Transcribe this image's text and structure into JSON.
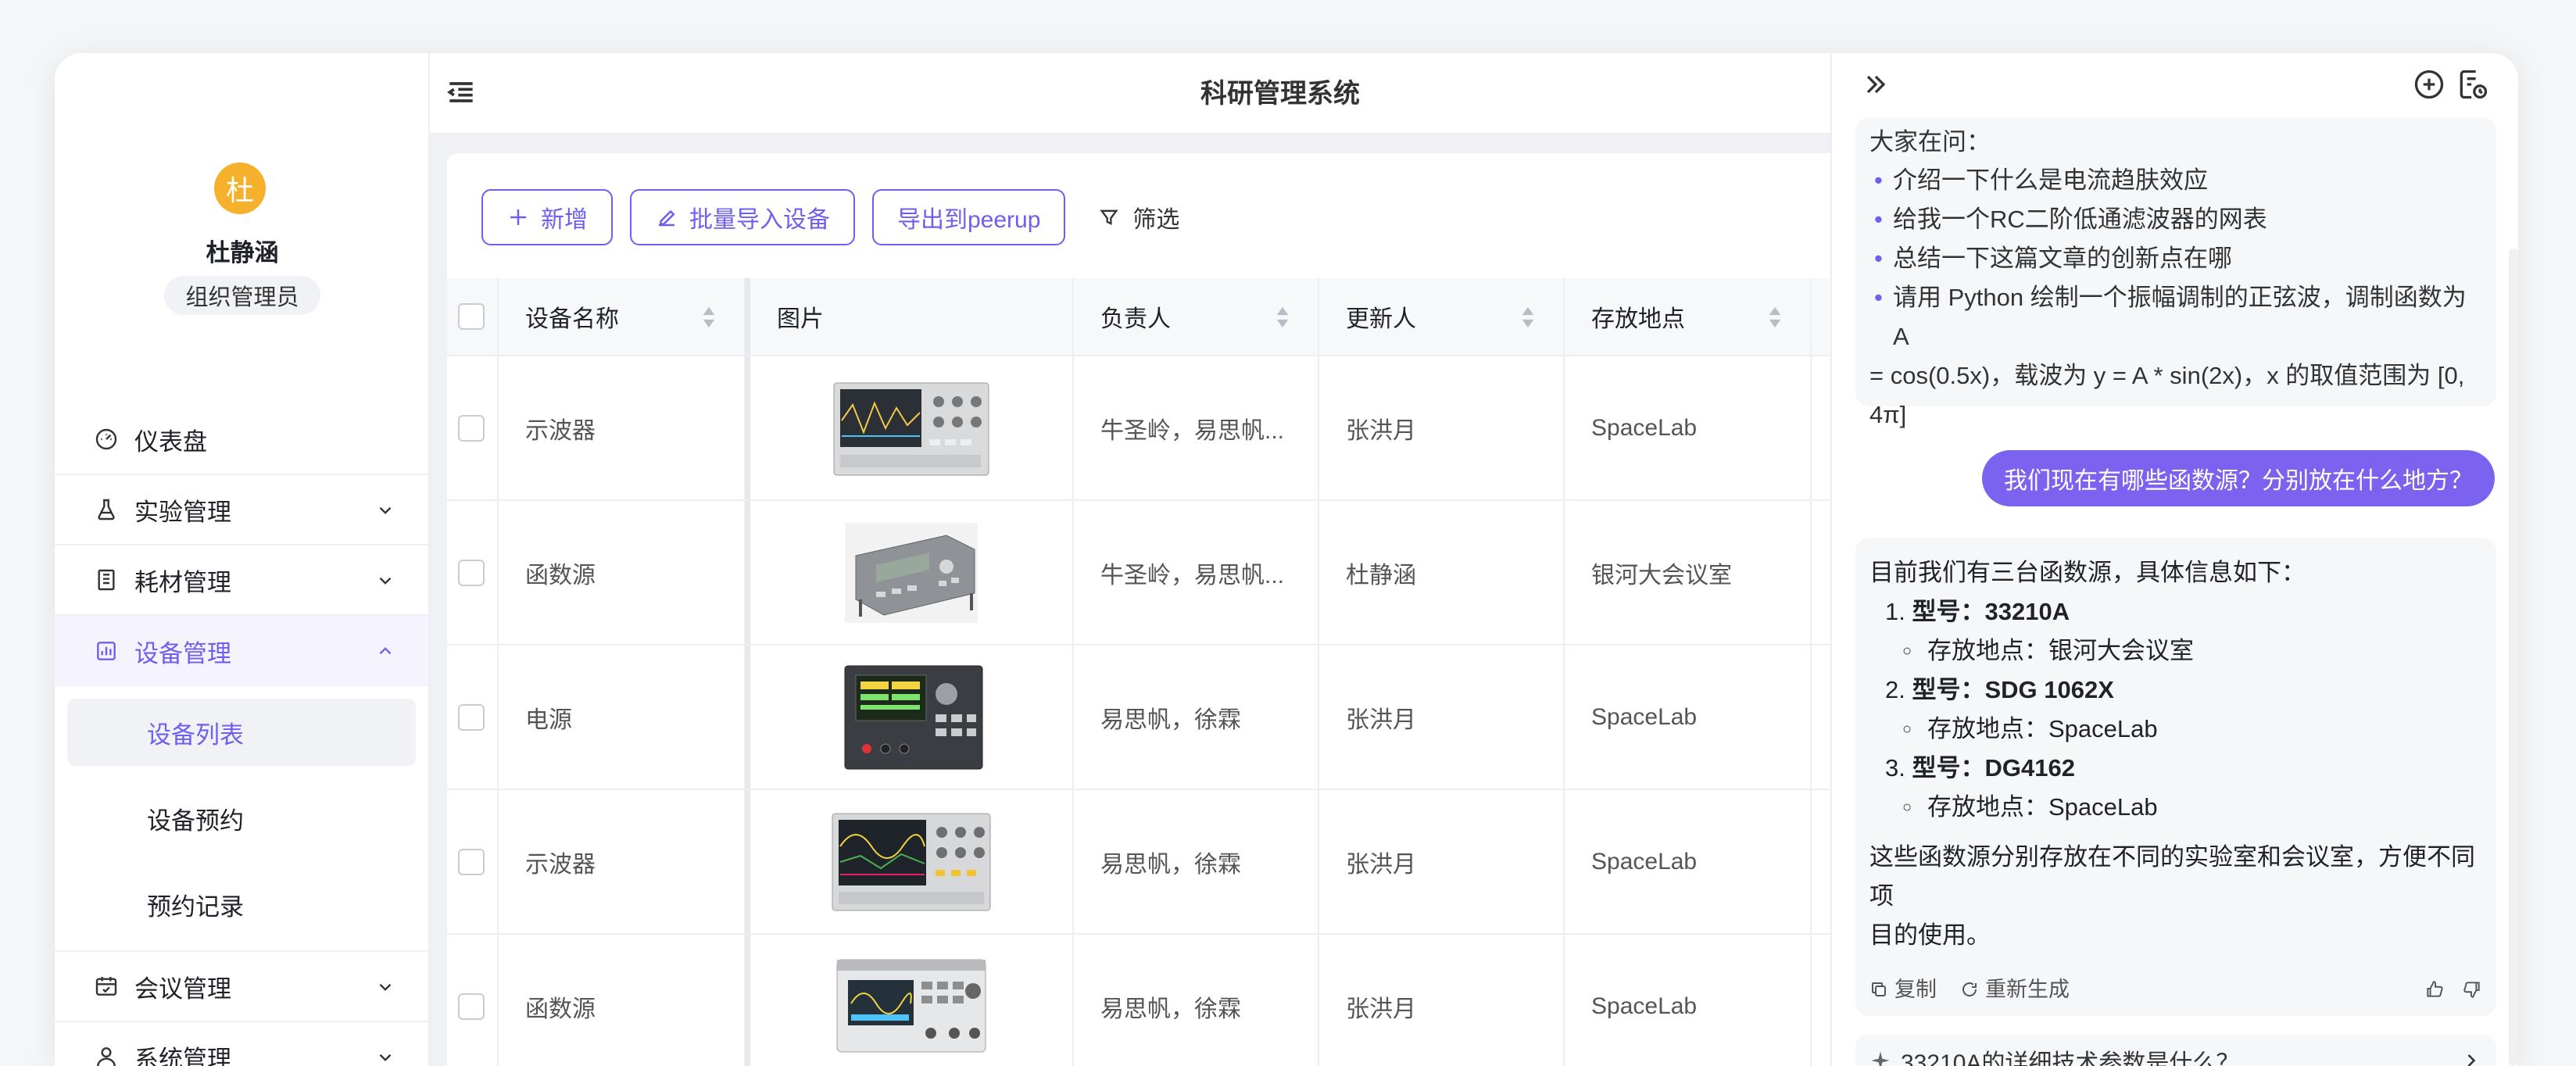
{
  "user": {
    "avatar_char": "杜",
    "name": "杜静涵",
    "role": "组织管理员"
  },
  "app_title": "科研管理系统",
  "nav": {
    "dashboard": "仪表盘",
    "experiments": "实验管理",
    "consumables": "耗材管理",
    "devices": "设备管理",
    "device_list": "设备列表",
    "device_booking": "设备预约",
    "booking_records": "预约记录",
    "meetings": "会议管理",
    "system": "系统管理"
  },
  "toolbar": {
    "add": "新增",
    "batch_import": "批量导入设备",
    "export": "导出到peerup",
    "filter": "筛选"
  },
  "table": {
    "headers": {
      "name": "设备名称",
      "image": "图片",
      "owner": "负责人",
      "updater": "更新人",
      "location": "存放地点"
    },
    "rows": [
      {
        "name": "示波器",
        "image_icon": "oscilloscope-image",
        "owner": "牛圣岭，易思帆...",
        "updater": "张洪月",
        "location": "SpaceLab"
      },
      {
        "name": "函数源",
        "image_icon": "function-generator-image",
        "owner": "牛圣岭，易思帆...",
        "updater": "杜静涵",
        "location": "银河大会议室"
      },
      {
        "name": "电源",
        "image_icon": "power-supply-image",
        "owner": "易思帆，徐霖",
        "updater": "张洪月",
        "location": "SpaceLab"
      },
      {
        "name": "示波器",
        "image_icon": "oscilloscope-image",
        "owner": "易思帆，徐霖",
        "updater": "张洪月",
        "location": "SpaceLab"
      },
      {
        "name": "函数源",
        "image_icon": "function-generator-image",
        "owner": "易思帆，徐霖",
        "updater": "张洪月",
        "location": "SpaceLab"
      }
    ]
  },
  "chat": {
    "prompt_header": "大家在问：",
    "prompts": [
      "介绍一下什么是电流趋肤效应",
      "给我一个RC二阶低通滤波器的网表",
      "总结一下这篇文章的创新点在哪",
      "请用 Python 绘制一个振幅调制的正弦波，调制函数为 A",
      "= cos(0.5x)，载波为 y = A * sin(2x)，x 的取值范围为 [0,",
      "4π]"
    ],
    "user_message": "我们现在有哪些函数源？分别放在什么地方？",
    "answer": {
      "intro": "目前我们有三台函数源，具体信息如下：",
      "items": [
        {
          "num": "1.",
          "label": "型号：",
          "model": "33210A",
          "loc_label": "存放地点：",
          "loc": "银河大会议室"
        },
        {
          "num": "2.",
          "label": "型号：",
          "model": "SDG 1062X",
          "loc_label": "存放地点：",
          "loc": "SpaceLab"
        },
        {
          "num": "3.",
          "label": "型号：",
          "model": "DG4162",
          "loc_label": "存放地点：",
          "loc": "SpaceLab"
        }
      ],
      "summary_line1": "这些函数源分别存放在不同的实验室和会议室，方便不同项",
      "summary_line2": "目的使用。"
    },
    "actions": {
      "copy": "复制",
      "regenerate": "重新生成"
    },
    "suggestion": "33210A的详细技术参数是什么？"
  },
  "colors": {
    "accent": "#6e5ff0",
    "avatar": "#f6b12c",
    "user_bubble": "#7b63f0"
  }
}
